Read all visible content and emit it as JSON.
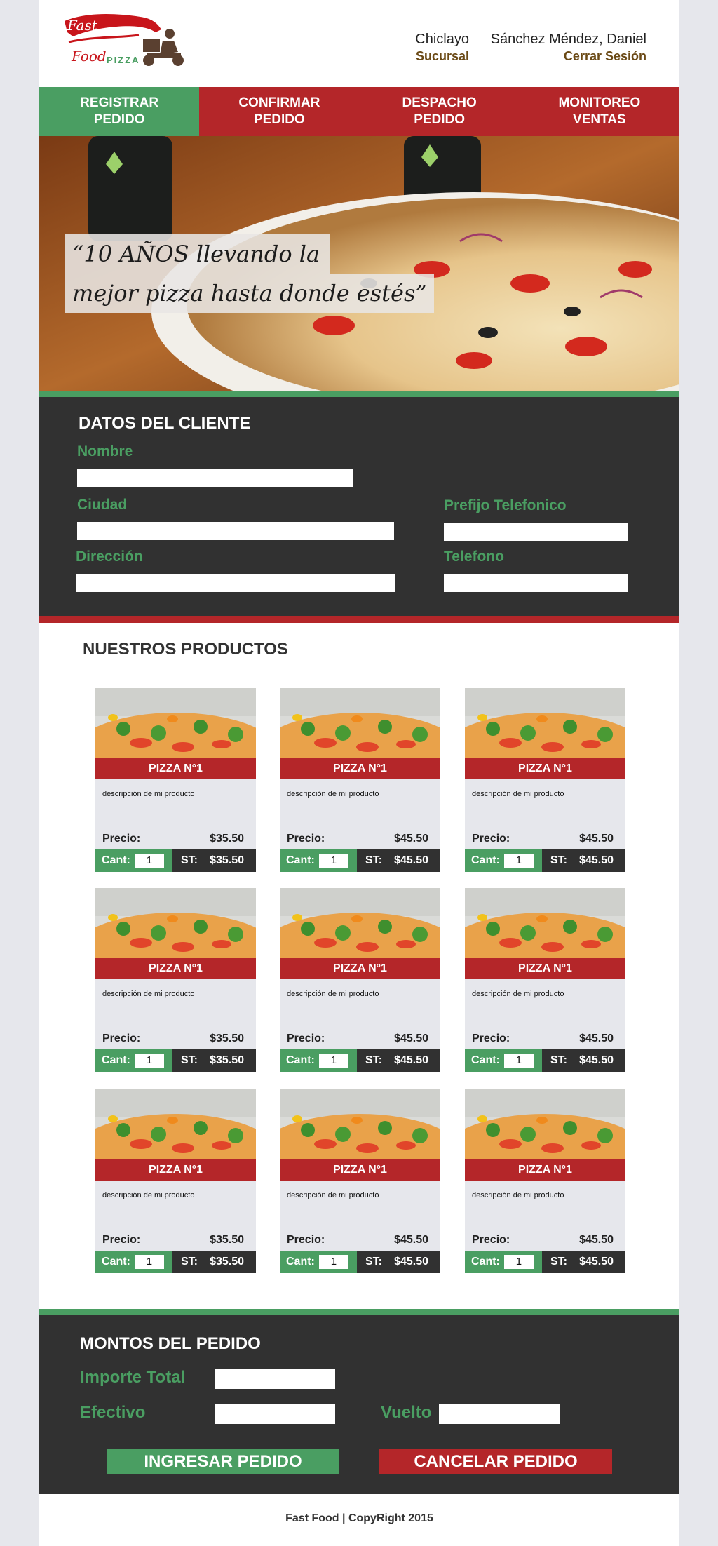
{
  "brand": {
    "name_line1": "Fast",
    "name_line2": "Food",
    "name_pizza": "PIZZA"
  },
  "header": {
    "branch_name": "Chiclayo",
    "branch_label": "Sucursal",
    "user_name": "Sánchez Méndez, Daniel",
    "logout_label": "Cerrar Sesión"
  },
  "nav": [
    {
      "label": "REGISTRAR\nPEDIDO",
      "active": true
    },
    {
      "label": "CONFIRMAR\nPEDIDO",
      "active": false
    },
    {
      "label": "DESPACHO\nPEDIDO",
      "active": false
    },
    {
      "label": "MONITOREO\nVENTAS",
      "active": false
    }
  ],
  "hero": {
    "quote_line1": "“10 AÑOS llevando  la",
    "quote_line2": "mejor pizza hasta donde estés”"
  },
  "client": {
    "title": "DATOS DEL CLIENTE",
    "nombre_label": "Nombre",
    "ciudad_label": "Ciudad",
    "prefijo_label": "Prefijo Telefonico",
    "direccion_label": "Dirección",
    "telefono_label": "Telefono"
  },
  "products": {
    "title": "NUESTROS PRODUCTOS",
    "price_label": "Precio:",
    "qty_label": "Cant:",
    "subtotal_label": "ST:",
    "items": [
      {
        "name": "PIZZA N°1",
        "desc": "descripción de mi producto",
        "price": "$35.50",
        "qty": "1",
        "st": "$35.50"
      },
      {
        "name": "PIZZA N°1",
        "desc": "descripción de mi producto",
        "price": "$45.50",
        "qty": "1",
        "st": "$45.50"
      },
      {
        "name": "PIZZA N°1",
        "desc": "descripción de mi producto",
        "price": "$45.50",
        "qty": "1",
        "st": "$45.50"
      },
      {
        "name": "PIZZA N°1",
        "desc": "descripción de mi producto",
        "price": "$35.50",
        "qty": "1",
        "st": "$35.50"
      },
      {
        "name": "PIZZA N°1",
        "desc": "descripción de mi producto",
        "price": "$45.50",
        "qty": "1",
        "st": "$45.50"
      },
      {
        "name": "PIZZA N°1",
        "desc": "descripción de mi producto",
        "price": "$45.50",
        "qty": "1",
        "st": "$45.50"
      },
      {
        "name": "PIZZA N°1",
        "desc": "descripción de mi producto",
        "price": "$35.50",
        "qty": "1",
        "st": "$35.50"
      },
      {
        "name": "PIZZA N°1",
        "desc": "descripción de mi producto",
        "price": "$45.50",
        "qty": "1",
        "st": "$45.50"
      },
      {
        "name": "PIZZA N°1",
        "desc": "descripción de mi producto",
        "price": "$45.50",
        "qty": "1",
        "st": "$45.50"
      }
    ]
  },
  "amounts": {
    "title": "MONTOS DEL PEDIDO",
    "total_label": "Importe Total",
    "cash_label": "Efectivo",
    "change_label": "Vuelto",
    "submit_label": "INGRESAR PEDIDO",
    "cancel_label": "CANCELAR PEDIDO"
  },
  "footer": {
    "text": "Fast Food | CopyRight 2015"
  },
  "colors": {
    "green": "#4a9e62",
    "red": "#b42629",
    "dark": "#313131",
    "brown": "#6b4a16"
  }
}
